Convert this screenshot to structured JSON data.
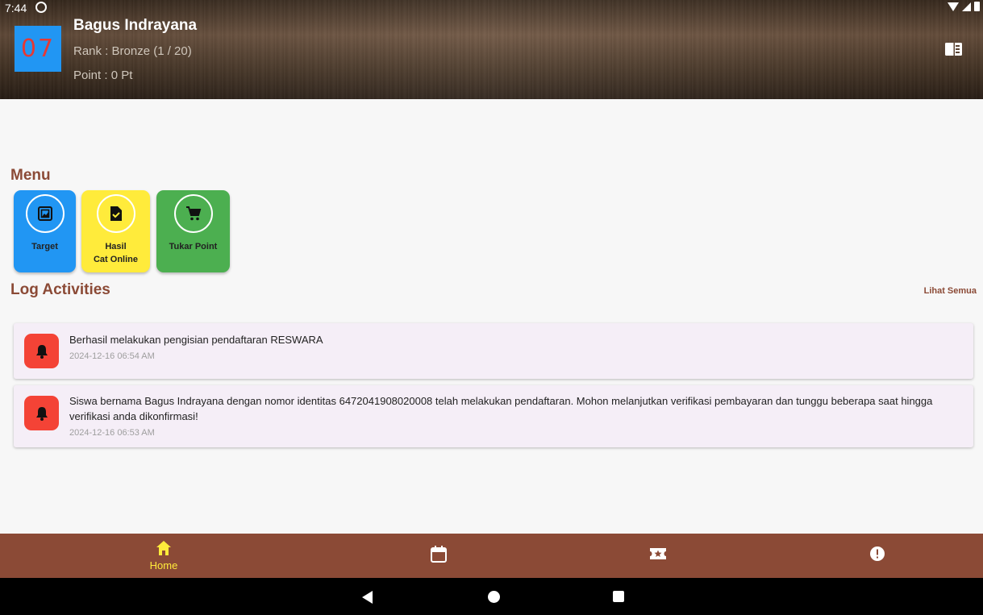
{
  "status_bar": {
    "time": "7:44"
  },
  "profile": {
    "avatar_text": "07",
    "name": "Bagus Indrayana",
    "rank": "Rank : Bronze (1 / 20)",
    "point": "Point : 0 Pt"
  },
  "menu": {
    "title": "Menu",
    "items": [
      {
        "label": "Target",
        "icon": "target-image-icon",
        "color": "#2196f3"
      },
      {
        "label": "Hasil\nCat Online",
        "icon": "document-check-icon",
        "color": "#ffeb3b"
      },
      {
        "label": "Tukar Point",
        "icon": "cart-icon",
        "color": "#4caf50"
      }
    ]
  },
  "log": {
    "title": "Log Activities",
    "see_all": "Lihat Semua",
    "items": [
      {
        "text": "Berhasil melakukan pengisian pendaftaran RESWARA",
        "time": "2024-12-16 06:54 AM"
      },
      {
        "text": "Siswa bernama Bagus Indrayana dengan nomor identitas 6472041908020008 telah melakukan pendaftaran. Mohon melanjutkan verifikasi pembayaran dan tunggu beberapa saat hingga verifikasi anda dikonfirmasi!",
        "time": "2024-12-16 06:53 AM"
      }
    ]
  },
  "bottom_nav": {
    "items": [
      {
        "label": "Home",
        "icon": "home-icon",
        "active": true
      },
      {
        "label": "",
        "icon": "calendar-icon"
      },
      {
        "label": "",
        "icon": "ticket-icon"
      },
      {
        "label": "",
        "icon": "alert-icon"
      }
    ]
  },
  "colors": {
    "accent": "#8b4a36",
    "active_nav": "#ffeb3b",
    "notification_icon_bg": "#f44336"
  }
}
